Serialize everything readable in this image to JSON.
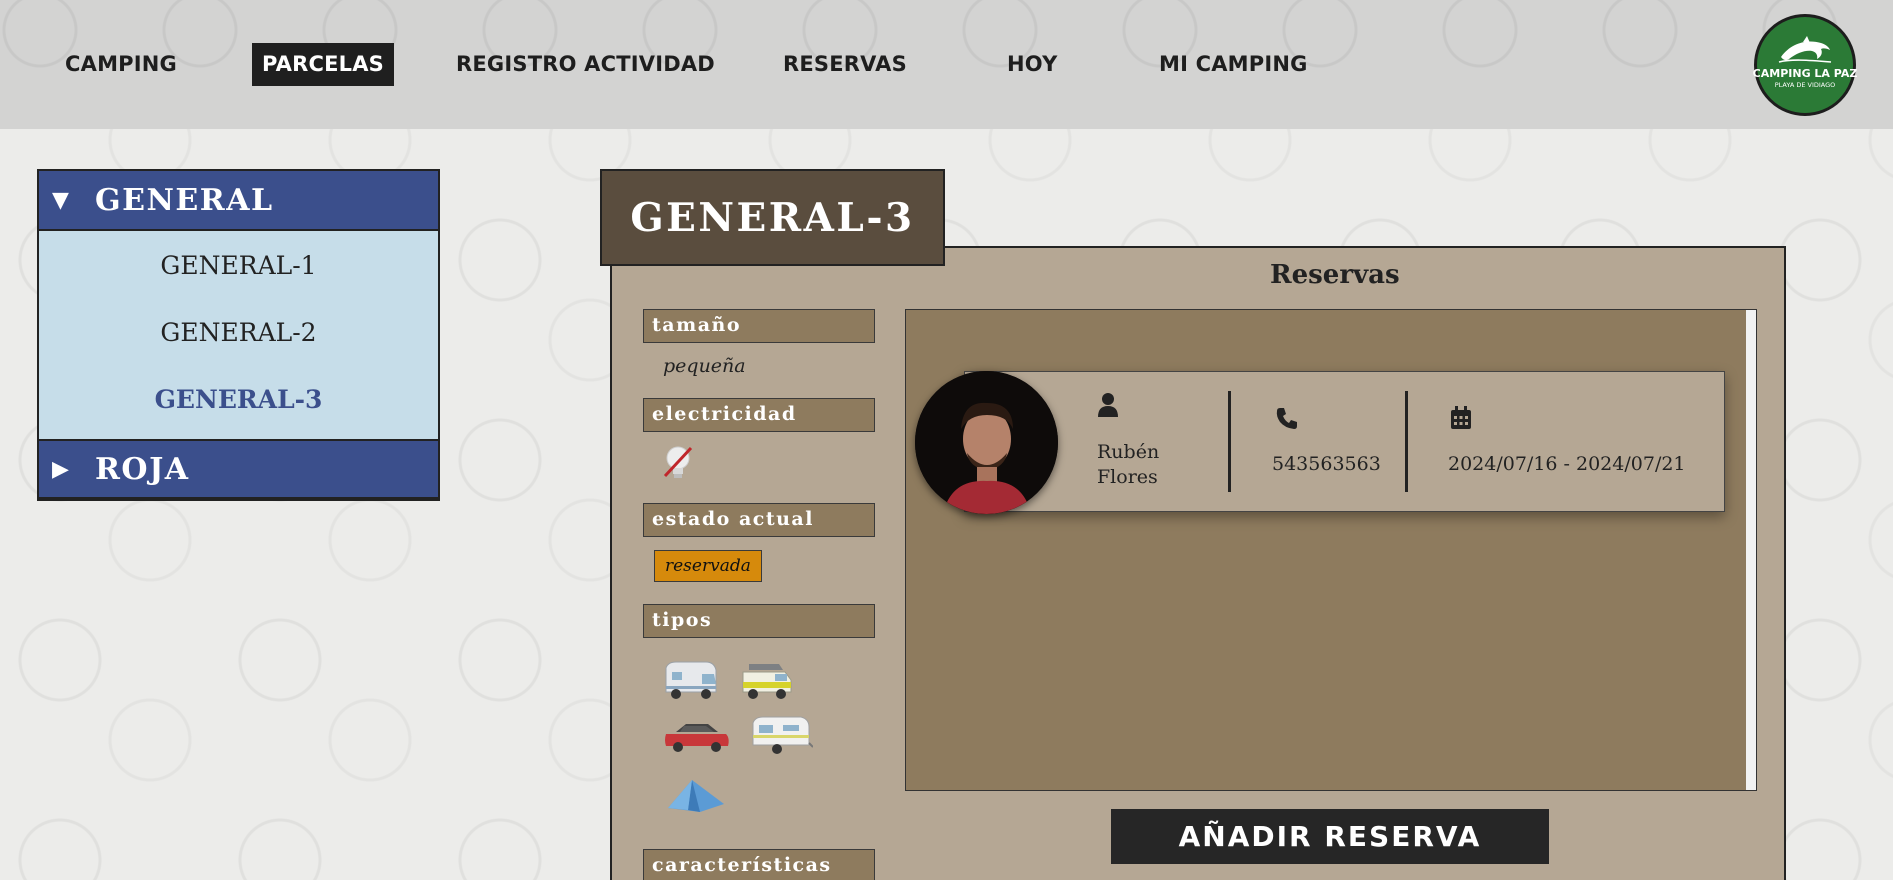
{
  "nav": {
    "items": [
      "CAMPING",
      "PARCELAS",
      "REGISTRO ACTIVIDAD",
      "RESERVAS",
      "HOY",
      "MI CAMPING"
    ],
    "active": "PARCELAS"
  },
  "logo": {
    "name": "CAMPING LA PAZ",
    "subtitle": "PLAYA DE VIDIAGO",
    "icon": "dolphin-icon"
  },
  "sidebar": {
    "groups": [
      {
        "label": "GENERAL",
        "expanded": true,
        "items": [
          "GENERAL-1",
          "GENERAL-2",
          "GENERAL-3"
        ],
        "active_item": "GENERAL-3"
      },
      {
        "label": "ROJA",
        "expanded": false,
        "items": []
      }
    ]
  },
  "parcel": {
    "title": "GENERAL-3",
    "size_label": "tamaño",
    "size_value": "pequeña",
    "electricity_label": "electricidad",
    "electricity_icon": "no-electricity-bulb-icon",
    "status_label": "estado actual",
    "status_value": "reservada",
    "status_color": "#d68a0c",
    "types_label": "tipos",
    "types": [
      "motorhome-icon",
      "camper-van-icon",
      "car-icon",
      "caravan-icon",
      "tent-icon"
    ],
    "features_label": "características"
  },
  "reservations": {
    "title": "Reservas",
    "list": [
      {
        "name": "Rubén Flores",
        "phone": "543563563",
        "dates": "2024/07/16 - 2024/07/21"
      }
    ],
    "add_button": "AÑADIR RESERVA"
  },
  "colors": {
    "navy": "#3b4f8c",
    "light_blue": "#c6dde9",
    "brown_dark": "#5a4d3e",
    "tan": "#b5a794",
    "brown_mid": "#8e7b5e",
    "logo_green": "#2b7a36"
  }
}
